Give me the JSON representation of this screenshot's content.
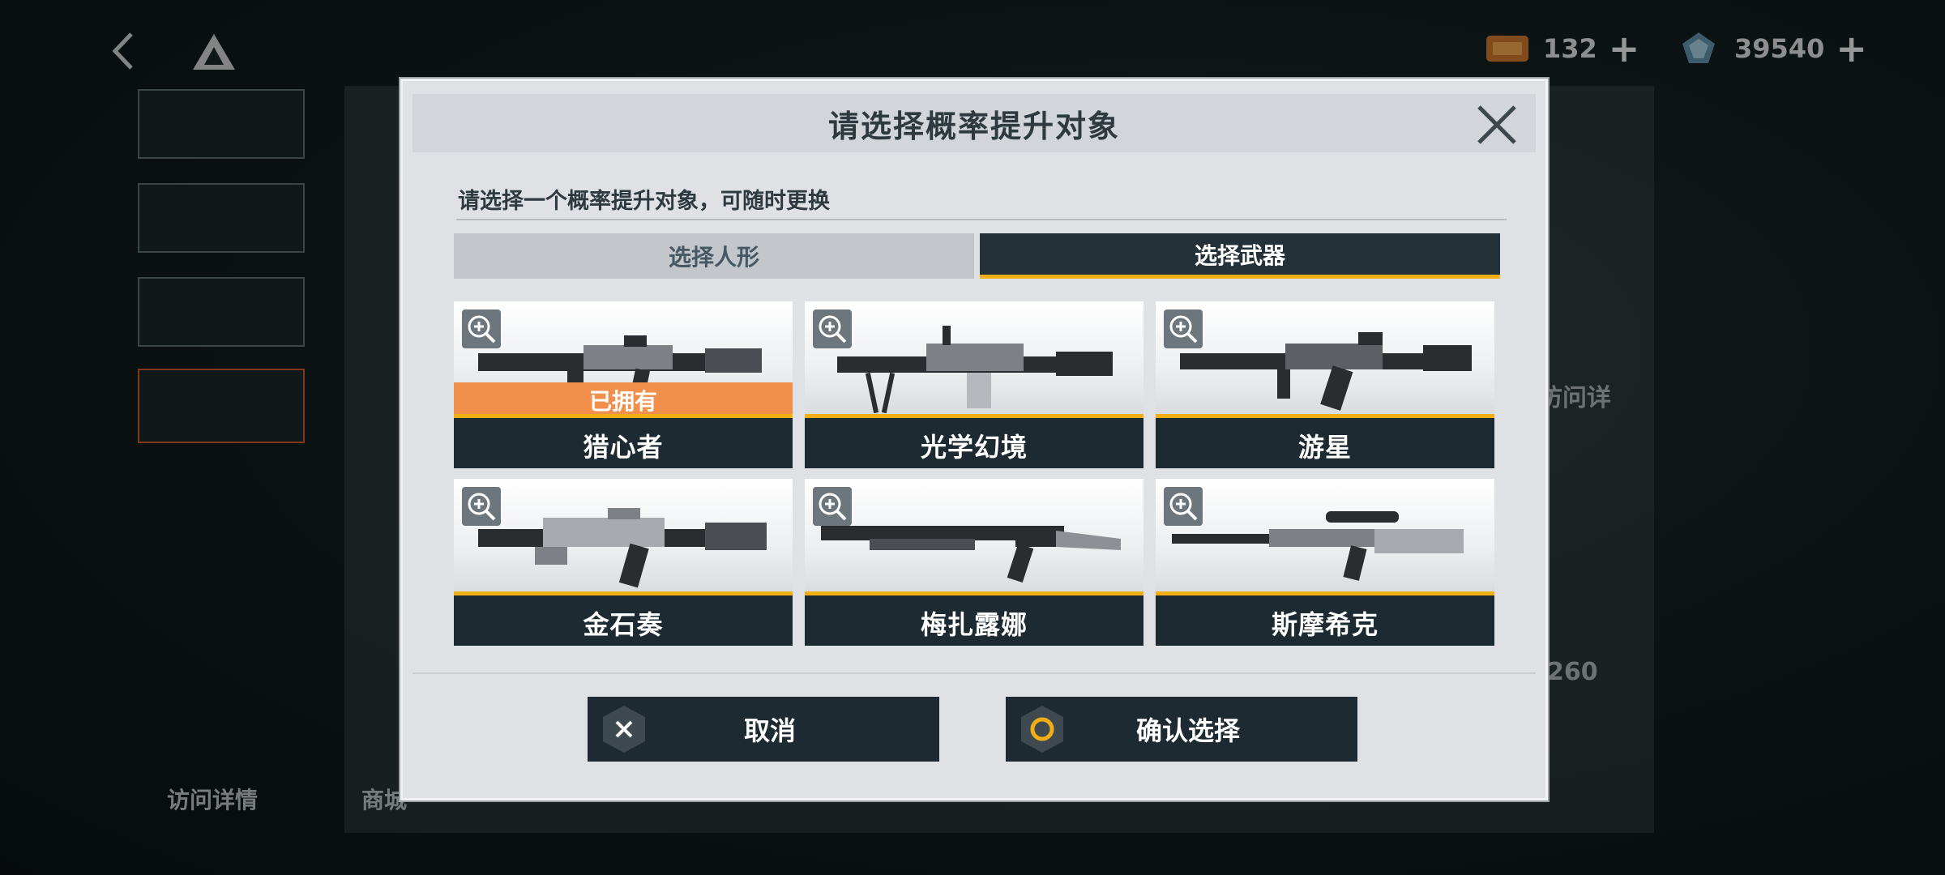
{
  "topbar": {
    "resource_1": {
      "icon": "ticket-icon",
      "count": "132"
    },
    "resource_2": {
      "icon": "crystal-icon",
      "count": "39540"
    },
    "plus": "+"
  },
  "background": {
    "bottom_tabs": [
      "访问详情",
      "商城"
    ],
    "side_text": "访问详",
    "side_count": "/260"
  },
  "modal": {
    "title": "请选择概率提升对象",
    "subtitle": "请选择一个概率提升对象，可随时更换",
    "tabs": {
      "character": "选择人形",
      "weapon": "选择武器"
    },
    "weapons": [
      {
        "name": "猎心者",
        "owned_label": "已拥有"
      },
      {
        "name": "光学幻境"
      },
      {
        "name": "游星"
      },
      {
        "name": "金石奏"
      },
      {
        "name": "梅扎露娜"
      },
      {
        "name": "斯摩希克"
      }
    ],
    "cancel_label": "取消",
    "confirm_label": "确认选择"
  },
  "colors": {
    "accent_yellow": "#f2ae15",
    "owned_orange": "#f28f4b",
    "dark_panel": "#1e2a31",
    "modal_bg": "#dfe1e4"
  }
}
